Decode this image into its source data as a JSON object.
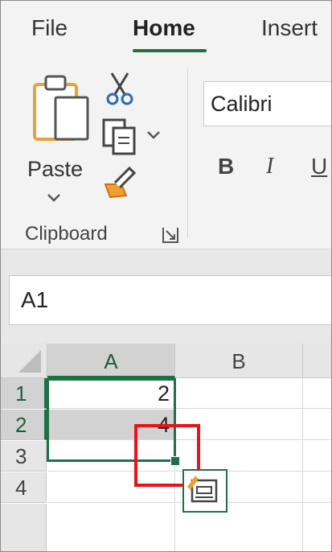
{
  "ribbon": {
    "tabs": [
      {
        "label": "File"
      },
      {
        "label": "Home"
      },
      {
        "label": "Insert"
      }
    ],
    "clipboard": {
      "paste_label": "Paste",
      "group_label": "Clipboard"
    },
    "font": {
      "name": "Calibri",
      "bold_label": "B",
      "italic_label": "I",
      "underline_label": "U"
    }
  },
  "name_box": {
    "value": "A1"
  },
  "sheet": {
    "columns": [
      "A",
      "B"
    ],
    "rows": [
      "1",
      "2",
      "3",
      "4"
    ],
    "cells": {
      "A1": "2",
      "A2": "4"
    }
  },
  "colors": {
    "accent": "#1e7145",
    "highlight": "#e8141c",
    "paste_orange": "#e6a23c"
  }
}
